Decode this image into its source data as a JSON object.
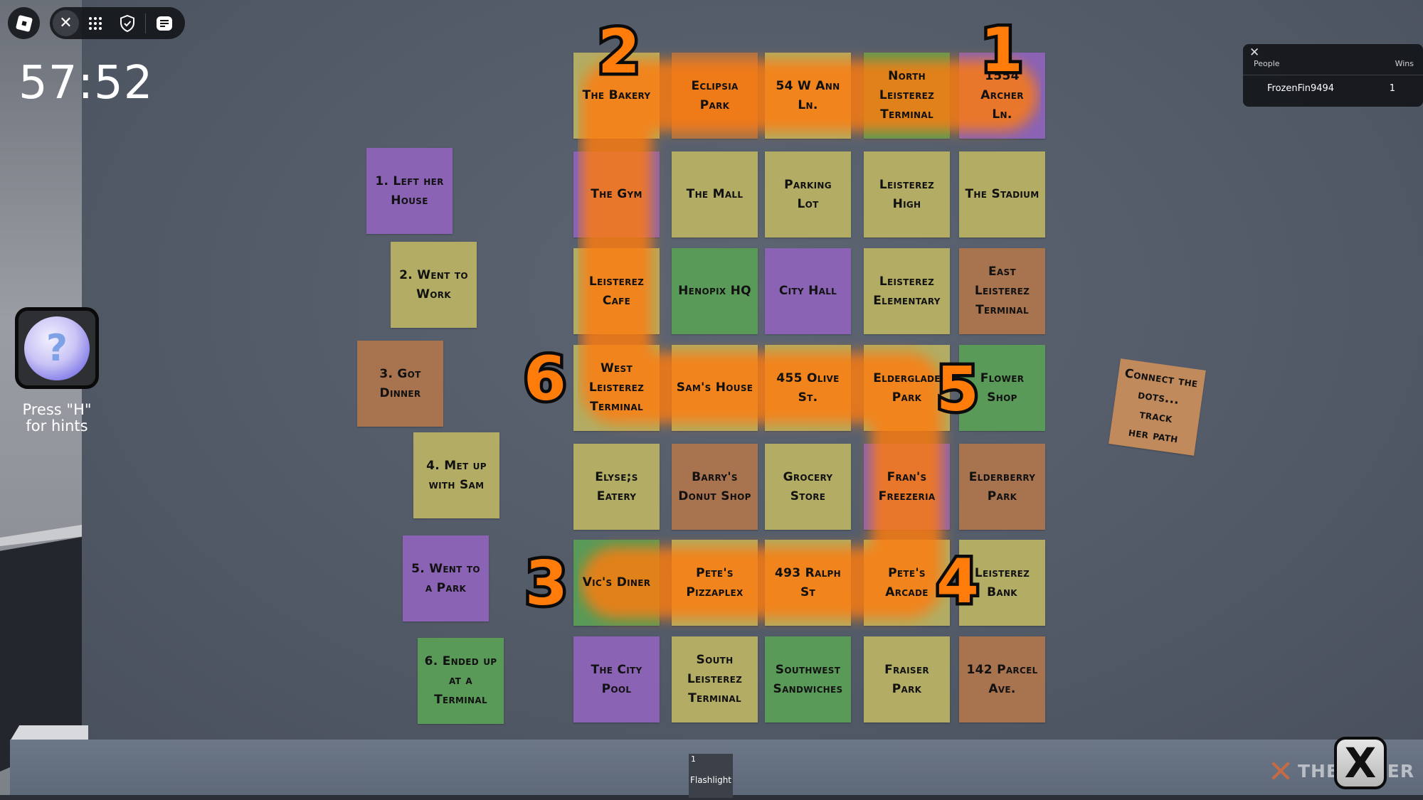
{
  "hud": {
    "timer": "57:52",
    "hint_label_line1": "Press \"H\"",
    "hint_label_line2": "for hints",
    "hint_icon": "question-mark-icon",
    "topbar_icons": [
      "roblox-logo-icon",
      "close-icon",
      "grid-menu-icon",
      "shield-check-icon",
      "chat-icon"
    ]
  },
  "leaderboard": {
    "close_label": "✕",
    "col_people": "People",
    "col_wins": "Wins",
    "rows": [
      {
        "name": "FrozenFin9494",
        "wins": "1"
      }
    ]
  },
  "hotbar": {
    "slot_number": "1",
    "slot_label": "Flashlight"
  },
  "exit_button_label": "X",
  "watermark": "THEGAMER",
  "clue_notes": [
    {
      "lines": [
        "1. Left her",
        "House"
      ],
      "color": "purple"
    },
    {
      "lines": [
        "2. Went to",
        "Work"
      ],
      "color": "olive"
    },
    {
      "lines": [
        "3. Got",
        "Dinner"
      ],
      "color": "brown"
    },
    {
      "lines": [
        "4. Met up",
        "with Sam"
      ],
      "color": "olive"
    },
    {
      "lines": [
        "5. Went to",
        "a Park"
      ],
      "color": "purple"
    },
    {
      "lines": [
        "6. Ended up",
        "at a",
        "Terminal"
      ],
      "color": "green"
    }
  ],
  "side_note": {
    "lines": [
      "Connect the",
      "dots... track",
      "her path"
    ],
    "color": "tan"
  },
  "grid": [
    [
      {
        "lines": [
          "The Bakery"
        ],
        "color": "olive"
      },
      {
        "lines": [
          "Eclipsia",
          "Park"
        ],
        "color": "brown"
      },
      {
        "lines": [
          "54 W Ann",
          "Ln."
        ],
        "color": "olive"
      },
      {
        "lines": [
          "North",
          "Leisterez",
          "Terminal"
        ],
        "color": "green"
      },
      {
        "lines": [
          "1554 Archer",
          "Ln."
        ],
        "color": "purple"
      }
    ],
    [
      {
        "lines": [
          "The Gym"
        ],
        "color": "purple"
      },
      {
        "lines": [
          "The Mall"
        ],
        "color": "olive"
      },
      {
        "lines": [
          "Parking",
          "Lot"
        ],
        "color": "olive"
      },
      {
        "lines": [
          "Leisterez",
          "High"
        ],
        "color": "olive"
      },
      {
        "lines": [
          "The Stadium"
        ],
        "color": "olive"
      }
    ],
    [
      {
        "lines": [
          "Leisterez",
          "Cafe"
        ],
        "color": "olive"
      },
      {
        "lines": [
          "Henopix HQ"
        ],
        "color": "green"
      },
      {
        "lines": [
          "City Hall"
        ],
        "color": "purple"
      },
      {
        "lines": [
          "Leisterez",
          "Elementary"
        ],
        "color": "olive"
      },
      {
        "lines": [
          "East",
          "Leisterez",
          "Terminal"
        ],
        "color": "brown"
      }
    ],
    [
      {
        "lines": [
          "West",
          "Leisterez",
          "Terminal"
        ],
        "color": "olive"
      },
      {
        "lines": [
          "Sam's House"
        ],
        "color": "olive"
      },
      {
        "lines": [
          "455 Olive",
          "St."
        ],
        "color": "olive"
      },
      {
        "lines": [
          "Elderglade",
          "Park"
        ],
        "color": "olive"
      },
      {
        "lines": [
          "Flower",
          "Shop"
        ],
        "color": "green"
      }
    ],
    [
      {
        "lines": [
          "Elyse;s",
          "Eatery"
        ],
        "color": "olive"
      },
      {
        "lines": [
          "Barry's",
          "Donut Shop"
        ],
        "color": "brown"
      },
      {
        "lines": [
          "Grocery",
          "Store"
        ],
        "color": "olive"
      },
      {
        "lines": [
          "Fran's",
          "Freezeria"
        ],
        "color": "purple"
      },
      {
        "lines": [
          "Elderberry",
          "Park"
        ],
        "color": "brown"
      }
    ],
    [
      {
        "lines": [
          "Vic's Diner"
        ],
        "color": "green"
      },
      {
        "lines": [
          "Pete's",
          "Pizzaplex"
        ],
        "color": "olive"
      },
      {
        "lines": [
          "493 Ralph",
          "St"
        ],
        "color": "olive"
      },
      {
        "lines": [
          "Pete's",
          "Arcade"
        ],
        "color": "olive"
      },
      {
        "lines": [
          "Leisterez",
          "Bank"
        ],
        "color": "olive"
      }
    ],
    [
      {
        "lines": [
          "The City",
          "Pool"
        ],
        "color": "purple"
      },
      {
        "lines": [
          "South",
          "Leisterez",
          "Terminal"
        ],
        "color": "olive"
      },
      {
        "lines": [
          "Southwest",
          "Sandwiches"
        ],
        "color": "green"
      },
      {
        "lines": [
          "Fraiser",
          "Park"
        ],
        "color": "olive"
      },
      {
        "lines": [
          "142 Parcel",
          "Ave."
        ],
        "color": "brown"
      }
    ]
  ],
  "path_markers": [
    {
      "label": "1",
      "at": "1554 Archer Ln."
    },
    {
      "label": "2",
      "at": "The Bakery"
    },
    {
      "label": "3",
      "at": "Vic's Diner"
    },
    {
      "label": "4",
      "at": "Pete's Arcade"
    },
    {
      "label": "5",
      "at": "Elderglade Park"
    },
    {
      "label": "6",
      "at": "West Leisterez Terminal"
    }
  ],
  "path_sequence": [
    [
      0,
      4
    ],
    [
      0,
      3
    ],
    [
      0,
      2
    ],
    [
      0,
      1
    ],
    [
      0,
      0
    ],
    [
      1,
      0
    ],
    [
      2,
      0
    ],
    [
      3,
      0
    ],
    [
      3,
      1
    ],
    [
      3,
      2
    ],
    [
      3,
      3
    ],
    [
      4,
      3
    ],
    [
      5,
      3
    ],
    [
      5,
      2
    ],
    [
      5,
      1
    ],
    [
      5,
      0
    ]
  ],
  "colors": {
    "olive": "#b2ac64",
    "purple": "#8a63b5",
    "green": "#5a9a58",
    "brown": "#a8734f",
    "tan": "#c08a5c",
    "path_orange": "#ff7c0a"
  }
}
